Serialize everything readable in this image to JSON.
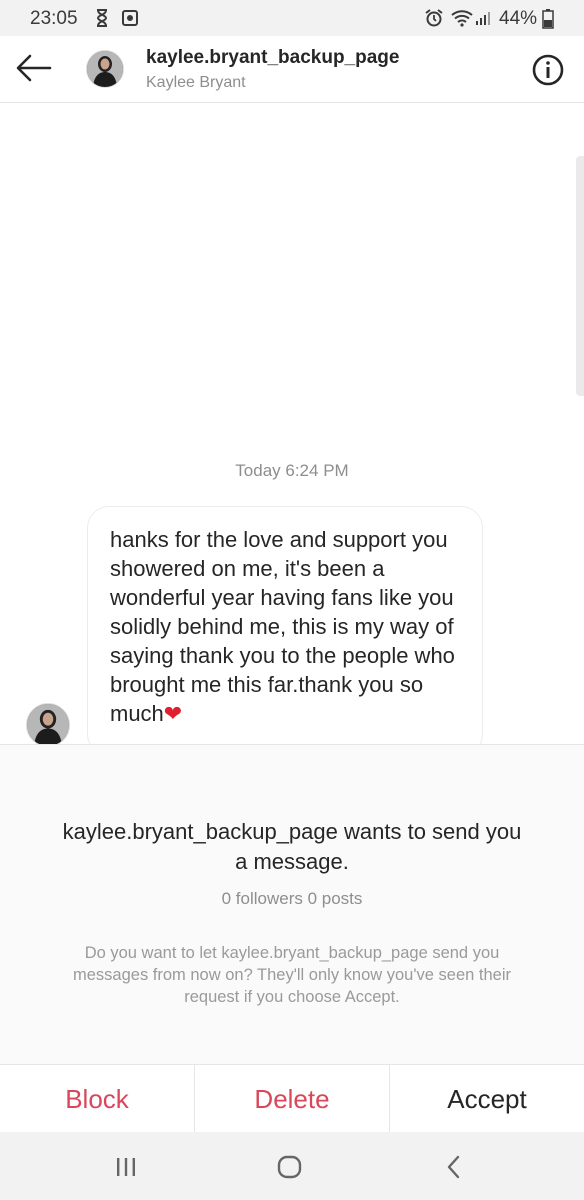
{
  "status_bar": {
    "time": "23:05",
    "battery_percent": "44%",
    "icons": [
      "hourglass-icon",
      "app-icon",
      "alarm-icon",
      "wifi-icon",
      "signal-icon",
      "battery-icon"
    ]
  },
  "header": {
    "username": "kaylee.bryant_backup_page",
    "full_name": "Kaylee Bryant",
    "icons": [
      "back-arrow-icon",
      "info-icon"
    ]
  },
  "conversation": {
    "timestamp": "Today 6:24 PM",
    "message": "hanks for the love and support you showered on me, it's been a wonderful year having fans like you solidly behind me, this is my way of saying thank you to the people who brought me this far.thank you so much",
    "message_emoji": "❤"
  },
  "request": {
    "username": "kaylee.bryant_backup_page",
    "title_suffix": "wants to send you a message.",
    "stats": "0 followers 0 posts",
    "description": "Do you want to let kaylee.bryant_backup_page send you messages from now on? They'll only know you've seen their request if you choose Accept."
  },
  "actions": {
    "block": "Block",
    "delete": "Delete",
    "accept": "Accept"
  },
  "colors": {
    "destructive": "#d9485a",
    "text_primary": "#262626",
    "text_secondary": "#8e8e8e"
  },
  "nav_bar": {
    "icons": [
      "recents-icon",
      "home-icon",
      "back-icon"
    ]
  }
}
